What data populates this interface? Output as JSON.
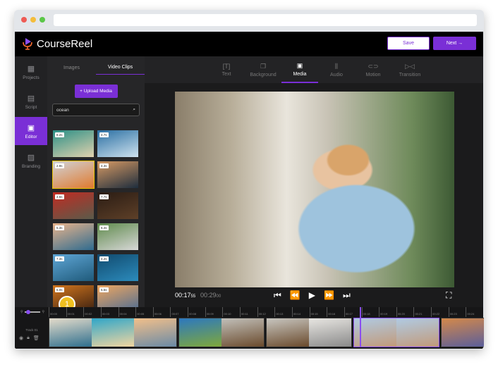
{
  "app": {
    "name": "CourseReel",
    "save_label": "Save",
    "next_label": "Next →"
  },
  "sidebar": {
    "items": [
      {
        "label": "Projects",
        "icon": "grid-icon"
      },
      {
        "label": "Script",
        "icon": "document-icon"
      },
      {
        "label": "Editor",
        "icon": "editor-icon",
        "active": true
      },
      {
        "label": "Branding",
        "icon": "image-icon"
      }
    ]
  },
  "panel": {
    "tabs": [
      "Images",
      "Video Clips"
    ],
    "active_tab": "Video Clips",
    "upload_label": "+ Upload Media",
    "search_value": "ocean",
    "clips": [
      {
        "duration": "8.2s",
        "colors": [
          "#2b8f86",
          "#e2d2ae"
        ]
      },
      {
        "duration": "4.7s",
        "colors": [
          "#2a6fa3",
          "#cfe2ee"
        ]
      },
      {
        "duration": "2.9s",
        "colors": [
          "#d0d3d8",
          "#e07a2e"
        ],
        "selected": true
      },
      {
        "duration": "4.3s",
        "colors": [
          "#d79a64",
          "#1e2d3d"
        ]
      },
      {
        "duration": "4.6s",
        "colors": [
          "#c22b22",
          "#5a5b4a"
        ]
      },
      {
        "duration": "7.7s",
        "colors": [
          "#2a1c14",
          "#5e4028"
        ]
      },
      {
        "duration": "5.3s",
        "colors": [
          "#e9b48c",
          "#2f6b8f"
        ]
      },
      {
        "duration": "6.4s",
        "colors": [
          "#5f8a4c",
          "#d8d8d8"
        ]
      },
      {
        "duration": "7.3s",
        "colors": [
          "#5fa6d6",
          "#1f5a7a"
        ]
      },
      {
        "duration": "4.2s",
        "colors": [
          "#114a6e",
          "#2c8bbc"
        ]
      },
      {
        "duration": "6.0s",
        "colors": [
          "#d2761e",
          "#3a1f10"
        ]
      },
      {
        "duration": "5.5s",
        "colors": [
          "#f0a760",
          "#4b6c94"
        ]
      }
    ]
  },
  "badge": "1",
  "toolbar": {
    "tools": [
      {
        "label": "Text",
        "icon": "text-icon"
      },
      {
        "label": "Background",
        "icon": "background-icon"
      },
      {
        "label": "Media",
        "icon": "media-icon",
        "active": true
      },
      {
        "label": "Audio",
        "icon": "audio-icon"
      },
      {
        "label": "Motion",
        "icon": "motion-icon"
      },
      {
        "label": "Transition",
        "icon": "transition-icon"
      }
    ]
  },
  "player": {
    "current_time": "00:17",
    "current_frames": "55",
    "total_time": "00:29",
    "total_frames": "00"
  },
  "timeline": {
    "track_label": "Track 01",
    "ticks": [
      "00:00",
      "00:01",
      "00:02",
      "00:03",
      "00:04",
      "00:05",
      "00:06",
      "00:07",
      "00:08",
      "00:09",
      "00:10",
      "00:11",
      "00:12",
      "00:13",
      "00:14",
      "00:15",
      "00:16",
      "00:17",
      "00:18",
      "00:19",
      "00:20",
      "00:21",
      "00:22",
      "00:23",
      "00:24"
    ],
    "clips": [
      {
        "frames": [
          [
            "#e5dccb",
            "#2f6f8e"
          ],
          [
            "#2fa6c9",
            "#f2d6a0"
          ],
          [
            "#f3c08a",
            "#6a8aa6"
          ]
        ]
      },
      {
        "frames": [
          [
            "#2c78c0",
            "#7fa83a"
          ],
          [
            "#c2c0ba",
            "#6a4a2c"
          ]
        ]
      },
      {
        "frames": [
          [
            "#c8c6c0",
            "#6a4a2c"
          ],
          [
            "#e8e6e2",
            "#8a8a8a"
          ]
        ]
      },
      {
        "frames": [
          [
            "#b0cbe3",
            "#c29a7a"
          ],
          [
            "#b0cbe3",
            "#c29a7a"
          ]
        ],
        "selected": true
      },
      {
        "frames": [
          [
            "#d4894a",
            "#5b5e9a"
          ],
          [
            "#3aa0a8",
            "#ddd"
          ]
        ]
      }
    ]
  }
}
